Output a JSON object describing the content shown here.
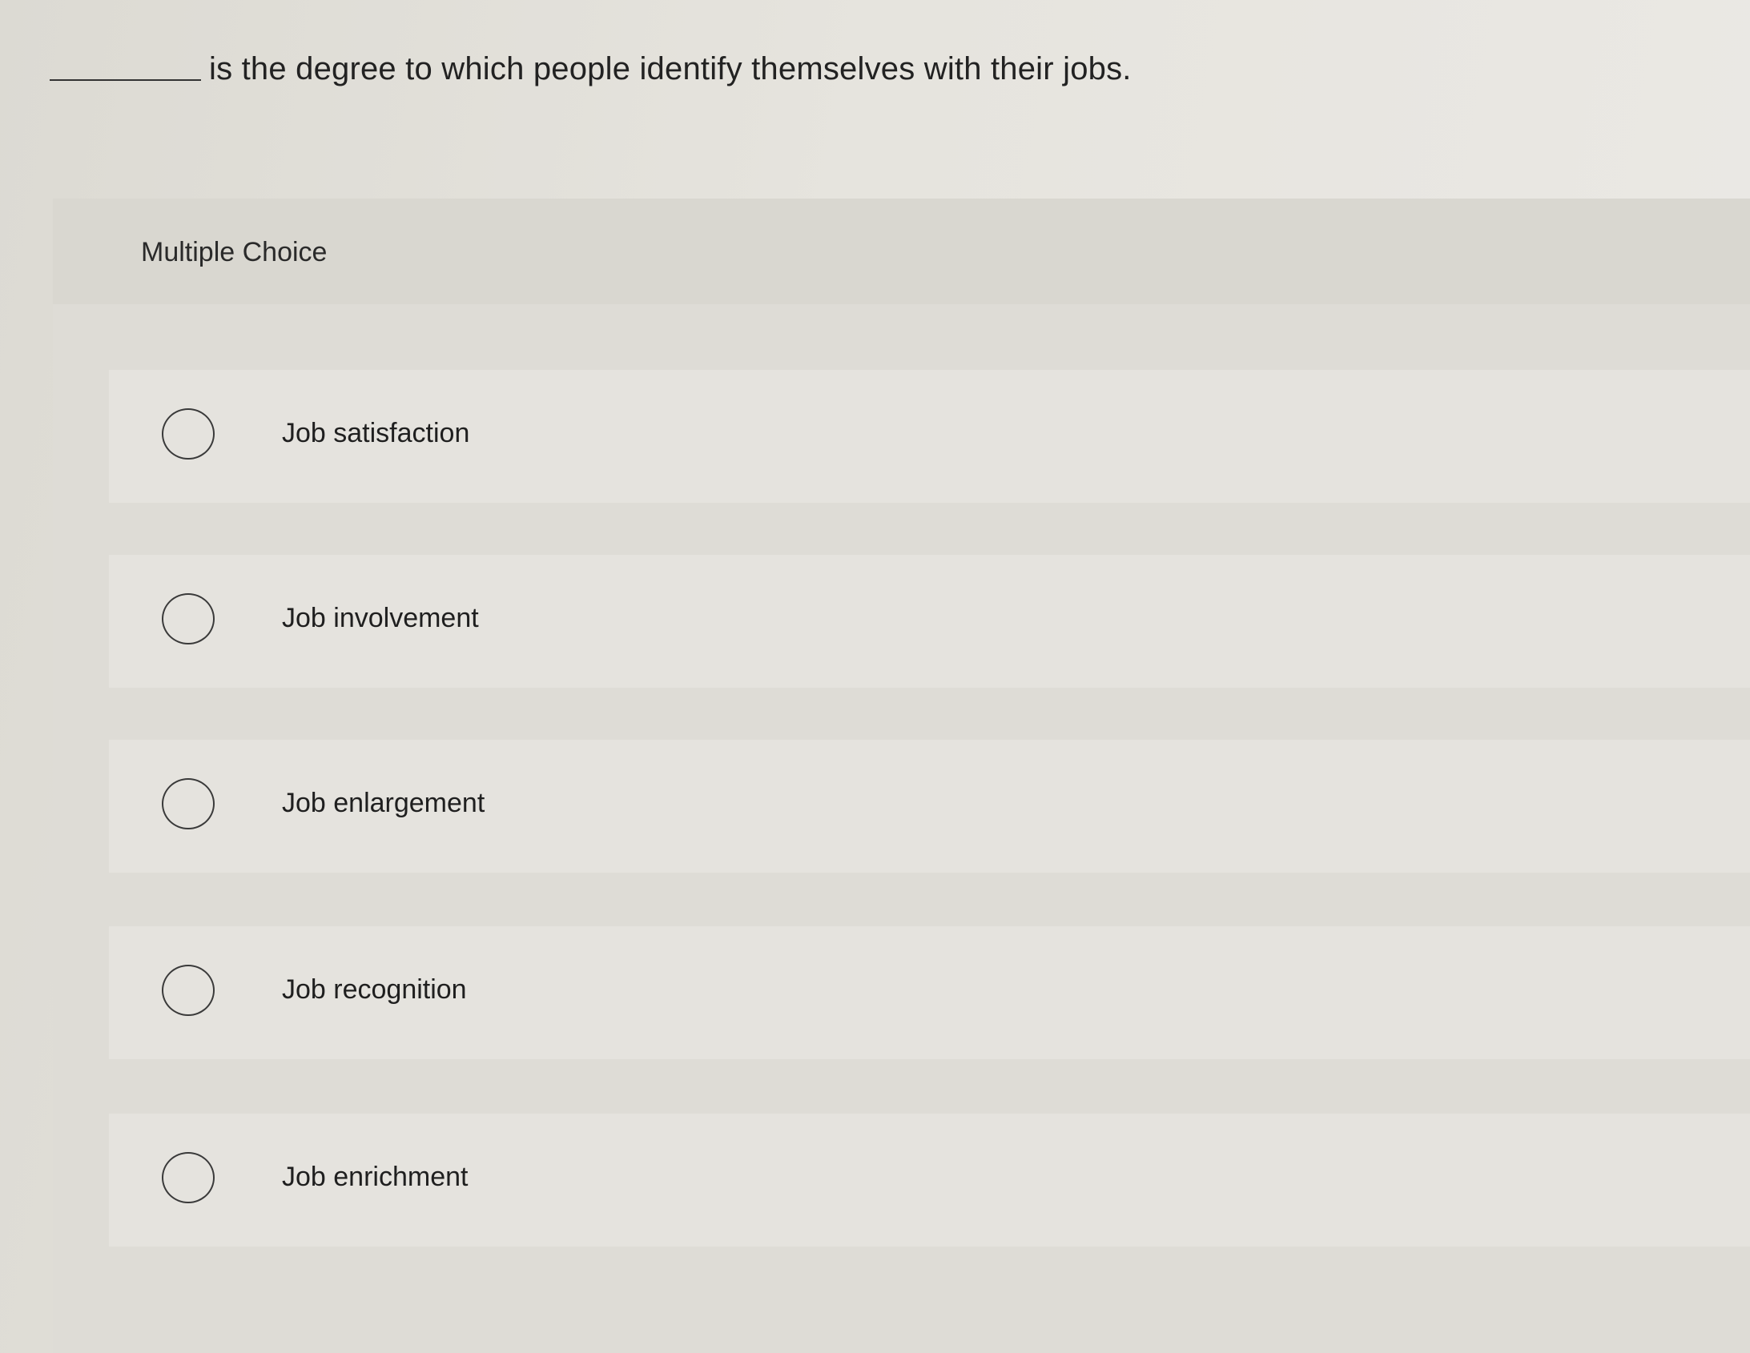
{
  "question": {
    "text": "is the degree to which people identify themselves with their jobs."
  },
  "section": {
    "title": "Multiple Choice"
  },
  "options": [
    {
      "label": "Job satisfaction"
    },
    {
      "label": "Job involvement"
    },
    {
      "label": "Job enlargement"
    },
    {
      "label": "Job recognition"
    },
    {
      "label": "Job enrichment"
    }
  ],
  "colors": {
    "background": "#e4e2dc",
    "panel": "#dedcd6",
    "option_row": "#e5e3de",
    "text": "#222222"
  }
}
